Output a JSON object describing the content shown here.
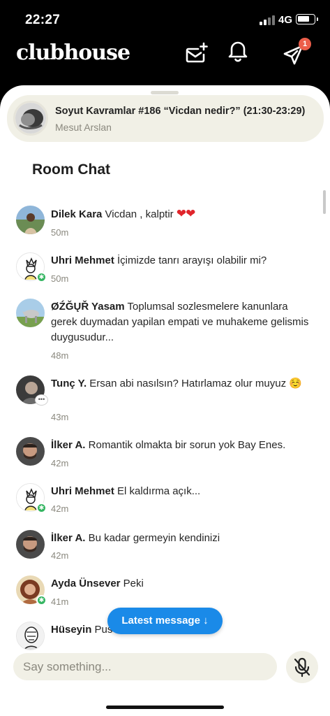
{
  "status_bar": {
    "time": "22:27",
    "network": "4G"
  },
  "header": {
    "logo": "clubhouse",
    "icons": [
      "invite-envelope-icon",
      "bell-icon",
      "paper-plane-icon"
    ],
    "notification_count": "1"
  },
  "room": {
    "title": "Soyut Kavramlar #186 “Vicdan nedir?” (21:30-23:29)",
    "host": "Mesut Arslan"
  },
  "chat": {
    "heading": "Room Chat",
    "messages": [
      {
        "name": "Dilek Kara",
        "text": "Vicdan , kalptir",
        "emoji": "❤❤",
        "time": "50m"
      },
      {
        "name": "Uhri Mehmet",
        "text": "İçimizde tanrı arayışı olabilir mi?",
        "time": "50m"
      },
      {
        "name": "ØŹĞŲŘ Yasam",
        "text": "Toplumsal sozlesmelere kanunlara gerek duymadan yapilan empati ve muhakeme gelismis duygusudur...",
        "time": "48m"
      },
      {
        "name": "Tunç Y.",
        "text": "Ersan abi nasılsın? Hatırlamaz olur muyuz ☺️",
        "time": "43m"
      },
      {
        "name": "İlker A.",
        "text": "Romantik olmakta bir sorun yok Bay Enes.",
        "time": "42m"
      },
      {
        "name": "Uhri Mehmet",
        "text": "El kaldırma açık...",
        "time": "42m"
      },
      {
        "name": "İlker A.",
        "text": "Bu kadar germeyin kendinizi",
        "time": "42m"
      },
      {
        "name": "Ayda Ünsever",
        "text": "Peki",
        "time": "41m"
      },
      {
        "name": "Hüseyin",
        "text": "Pus",
        "time": ""
      }
    ]
  },
  "latest_button": "Latest message ↓",
  "input": {
    "placeholder": "Say something..."
  },
  "colors": {
    "accent_blue": "#1a8ae8",
    "banner_bg": "#f1f0e6",
    "badge_red": "#ec5e4a",
    "online_green": "#34b561"
  }
}
